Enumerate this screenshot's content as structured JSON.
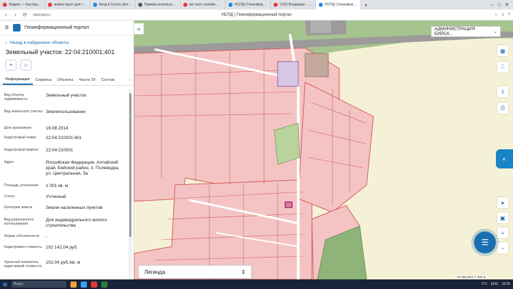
{
  "browser": {
    "tabs": [
      {
        "label": "Яндекс — быстрый поиск",
        "color": "#e53935"
      },
      {
        "label": "можно грунт для газона",
        "color": "#e53935"
      },
      {
        "label": "Вход в Гостех (Аутентик",
        "color": "#1e88e5"
      },
      {
        "label": "Пример использования",
        "color": "#555555"
      },
      {
        "label": "же текст онлайн — Янд",
        "color": "#e53935"
      },
      {
        "label": "НСПД | Геоинформацион",
        "color": "#1e88e5"
      },
      {
        "label": "(132) Входящие - Почта",
        "color": "#e53935"
      },
      {
        "label": "НСПД | Геоинформацио",
        "color": "#1e88e5"
      }
    ],
    "active_tab": 7,
    "url": "nspd.gov.ru",
    "page_title": "НСПД | Геоинформационный портал"
  },
  "app": {
    "title": "Геоинформационный портал",
    "back_label": "Назад в найденные объекты",
    "plot_title": "Земельный участок: 22:04:210001:401"
  },
  "tabs": [
    {
      "label": "Информация",
      "active": true
    },
    {
      "label": "Сервисы",
      "active": false
    },
    {
      "label": "Объекты",
      "active": false
    },
    {
      "label": "Части ЗУ",
      "active": false
    },
    {
      "label": "Состав",
      "active": false
    }
  ],
  "tabs_more": "›",
  "properties": [
    {
      "label": "Вид объекта недвижимости",
      "value": "Земельный участок"
    },
    {
      "label": "Вид земельного участка",
      "value": "Землепользование"
    },
    {
      "label": "Дата присвоения",
      "value": "19.08.2014"
    },
    {
      "label": "Кадастровый номер",
      "value": "22:04:210001:401"
    },
    {
      "label": "Кадастровый квартал",
      "value": "22:04:210001"
    },
    {
      "label": "Адрес",
      "value": "Российская Федерация, Алтайский край, Бийский район, п. Полеводка, ул. Центральная, 5а"
    },
    {
      "label": "Площадь уточненная",
      "value": "1 001 кв. м"
    },
    {
      "label": "Статус",
      "value": "Учтенный"
    },
    {
      "label": "Категория земель",
      "value": "Земли населенных пунктов"
    },
    {
      "label": "Вид разрешенного использования",
      "value": "Для индивидуального жилого строительства"
    },
    {
      "label": "Форма собственности",
      "value": "-"
    },
    {
      "label": "Кадастровая стоимость",
      "value": "102 142,04 руб."
    },
    {
      "label": "Удельный показатель кадастровой стоимости",
      "value": "102,04 руб./кв. м"
    }
  ],
  "map": {
    "admin_select": "АДМИНИСТРАЦИЯ БИЙСК...",
    "legend": "Легенда",
    "copyright": "НСПД 2024 ©",
    "scale": "300 м",
    "colors": {
      "parcel_fill": "#f4c4c4",
      "parcel_stroke": "#d25a5a",
      "field": "#f5f1d6",
      "green": "#8fb47a",
      "road": "#9c9a9a"
    }
  },
  "taskbar": {
    "search_placeholder": "Поиск",
    "lang": "ENG",
    "time": "18:35",
    "weather": "5°C"
  }
}
